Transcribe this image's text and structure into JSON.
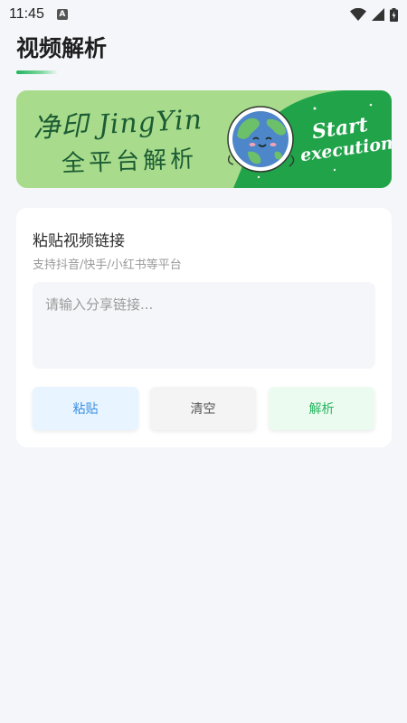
{
  "status_bar": {
    "time": "11:45",
    "notification_icon": "a-letter-icon",
    "wifi_icon": "wifi-icon",
    "signal_icon": "cell-signal-icon",
    "battery_icon": "battery-charging-icon"
  },
  "page": {
    "title": "视频解析"
  },
  "banner": {
    "script_line_1": "净印 JingYin",
    "script_line_2": "全平台解析",
    "cta_line_1": "Start",
    "cta_line_2": "execution",
    "mascot_icon": "smiling-earth-icon"
  },
  "card": {
    "title": "粘贴视频链接",
    "subtitle": "支持抖音/快手/小红书等平台",
    "input": {
      "value": "",
      "placeholder": "请输入分享链接..."
    },
    "buttons": {
      "paste": "粘贴",
      "clear": "清空",
      "parse": "解析"
    }
  },
  "colors": {
    "background": "#f5f6fa",
    "banner_light_green": "#a8dc8c",
    "banner_dark_green": "#21a34a",
    "paste_text": "#3a8fe0",
    "parse_text": "#26b560"
  }
}
